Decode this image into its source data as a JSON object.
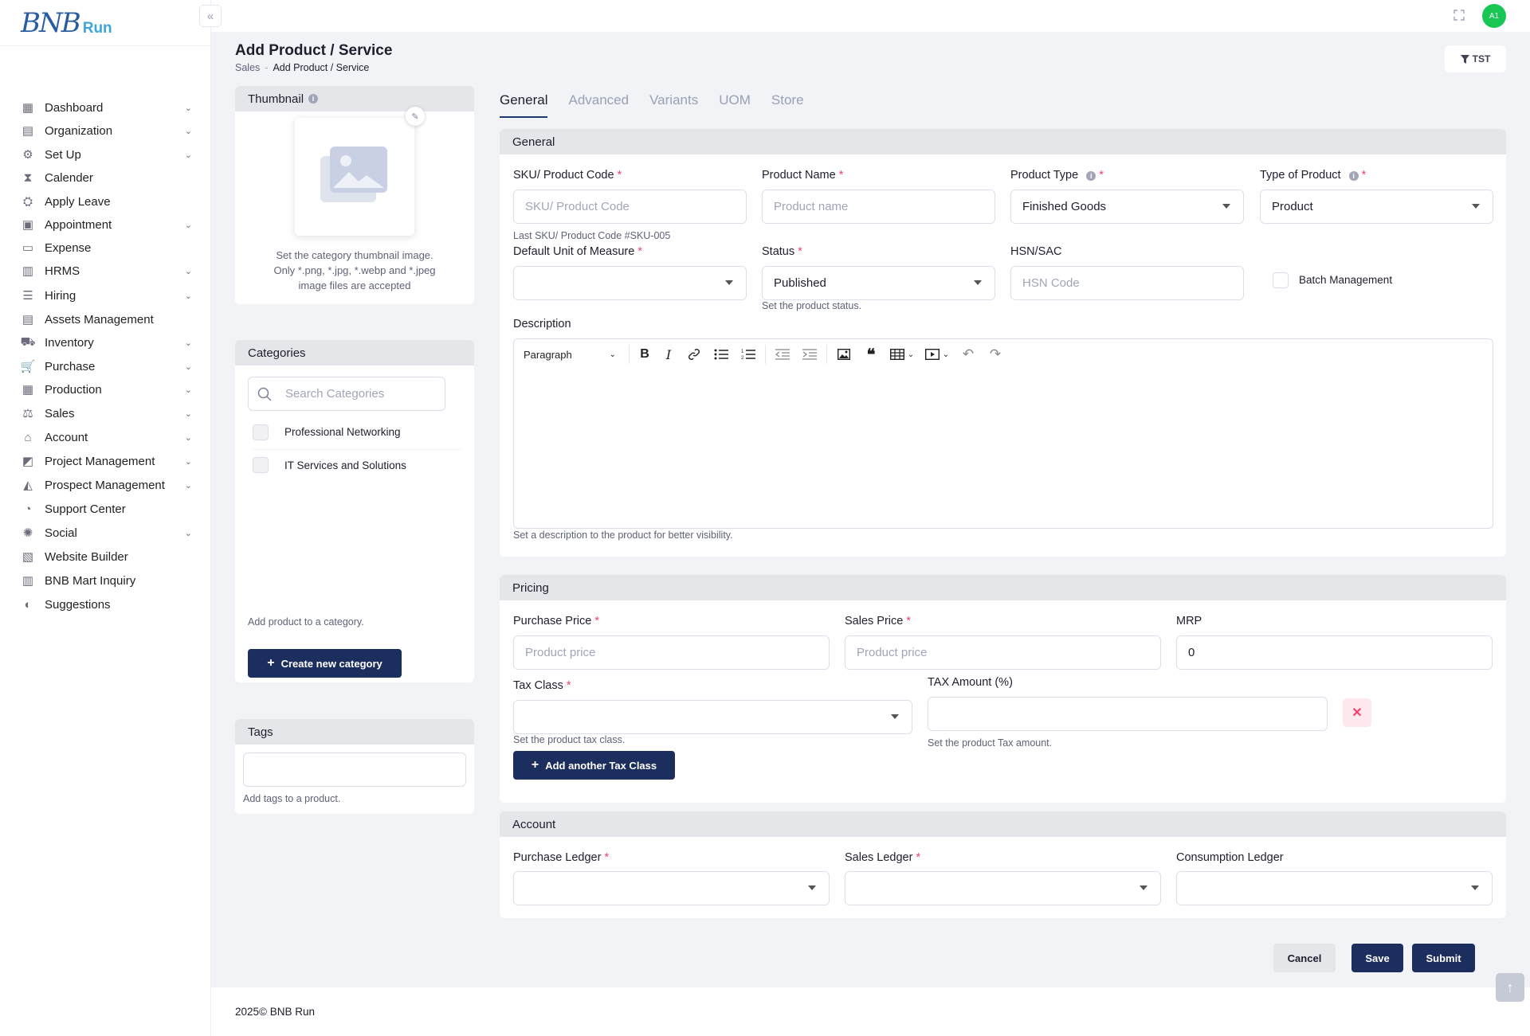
{
  "brand": {
    "logo_mark": "BNB",
    "logo_run": "Run"
  },
  "sidebar": {
    "items": [
      {
        "label": "Dashboard",
        "icon": "dashboard-icon",
        "chevron": true
      },
      {
        "label": "Organization",
        "icon": "organization-icon",
        "chevron": true
      },
      {
        "label": "Set Up",
        "icon": "setup-icon",
        "chevron": true
      },
      {
        "label": "Calender",
        "icon": "hourglass-icon",
        "chevron": false
      },
      {
        "label": "Apply Leave",
        "icon": "leave-icon",
        "chevron": false
      },
      {
        "label": "Appointment",
        "icon": "calendar-icon",
        "chevron": true
      },
      {
        "label": "Expense",
        "icon": "expense-icon",
        "chevron": false
      },
      {
        "label": "HRMS",
        "icon": "hrms-icon",
        "chevron": true
      },
      {
        "label": "Hiring",
        "icon": "hiring-icon",
        "chevron": true
      },
      {
        "label": "Assets Management",
        "icon": "assets-icon",
        "chevron": false
      },
      {
        "label": "Inventory",
        "icon": "inventory-icon",
        "chevron": true
      },
      {
        "label": "Purchase",
        "icon": "cart-icon",
        "chevron": true
      },
      {
        "label": "Production",
        "icon": "factory-icon",
        "chevron": true
      },
      {
        "label": "Sales",
        "icon": "sales-icon",
        "chevron": true
      },
      {
        "label": "Account",
        "icon": "bank-icon",
        "chevron": true
      },
      {
        "label": "Project Management",
        "icon": "project-icon",
        "chevron": true
      },
      {
        "label": "Prospect Management",
        "icon": "prospect-icon",
        "chevron": true
      },
      {
        "label": "Support Center",
        "icon": "support-icon",
        "chevron": false
      },
      {
        "label": "Social",
        "icon": "social-icon",
        "chevron": true
      },
      {
        "label": "Website Builder",
        "icon": "website-icon",
        "chevron": false
      },
      {
        "label": "BNB Mart Inquiry",
        "icon": "inquiry-icon",
        "chevron": false
      },
      {
        "label": "Suggestions",
        "icon": "toggle-icon",
        "chevron": false
      }
    ]
  },
  "topbar": {
    "avatar": "A1"
  },
  "header": {
    "title": "Add Product / Service",
    "breadcrumb": [
      "Sales",
      "Add Product / Service"
    ],
    "filter_label": "TST"
  },
  "thumbnail": {
    "title": "Thumbnail",
    "hint_line1": "Set the category thumbnail image.",
    "hint_line2": "Only *.png, *.jpg, *.webp and *.jpeg",
    "hint_line3": "image files are accepted"
  },
  "categories": {
    "title": "Categories",
    "search_placeholder": "Search Categories",
    "items": [
      "Professional Networking",
      "IT Services and Solutions"
    ],
    "hint": "Add product to a category.",
    "create_label": "Create new category"
  },
  "tags": {
    "title": "Tags",
    "hint": "Add tags to a product."
  },
  "tabs": [
    "General",
    "Advanced",
    "Variants",
    "UOM",
    "Store"
  ],
  "general": {
    "title": "General",
    "sku_label": "SKU/ Product Code",
    "sku_placeholder": "SKU/ Product Code",
    "sku_hint": "Last SKU/ Product Code #SKU-005",
    "name_label": "Product Name",
    "name_placeholder": "Product name",
    "type_label": "Product Type",
    "type_value": "Finished Goods",
    "kind_label": "Type of Product",
    "kind_value": "Product",
    "uom_label": "Default Unit of Measure",
    "status_label": "Status",
    "status_value": "Published",
    "status_hint": "Set the product status.",
    "hsn_label": "HSN/SAC",
    "hsn_placeholder": "HSN Code",
    "batch_label": "Batch Management",
    "desc_label": "Description",
    "desc_format": "Paragraph",
    "desc_hint": "Set a description to the product for better visibility."
  },
  "pricing": {
    "title": "Pricing",
    "purchase_label": "Purchase Price",
    "purchase_placeholder": "Product price",
    "sales_label": "Sales Price",
    "sales_placeholder": "Product price",
    "mrp_label": "MRP",
    "mrp_value": "0",
    "tax_class_label": "Tax Class",
    "tax_class_hint": "Set the product tax class.",
    "tax_amount_label": "TAX Amount (%)",
    "tax_amount_hint": "Set the product Tax amount.",
    "add_tax_label": "Add another Tax Class"
  },
  "account": {
    "title": "Account",
    "purchase_ledger_label": "Purchase Ledger",
    "sales_ledger_label": "Sales Ledger",
    "consumption_ledger_label": "Consumption Ledger"
  },
  "actions": {
    "cancel": "Cancel",
    "save": "Save",
    "submit": "Submit"
  },
  "footer": {
    "text": "2025© BNB Run"
  },
  "colors": {
    "primary": "#1c2e5e",
    "required": "#f1416c",
    "avatar": "#17c653"
  }
}
